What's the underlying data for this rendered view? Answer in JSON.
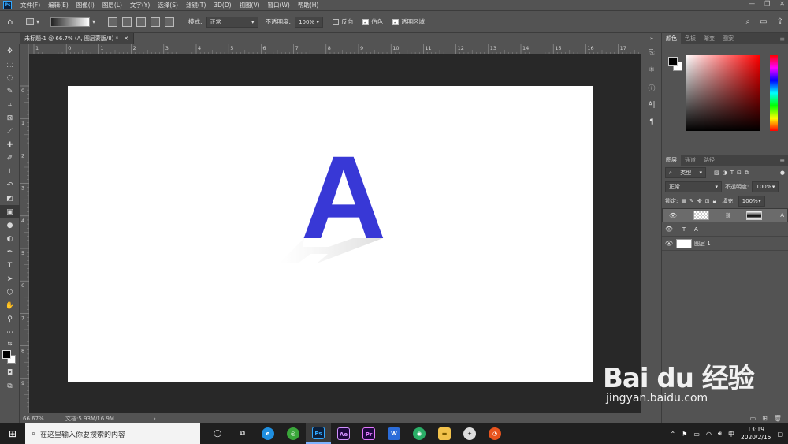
{
  "menubar": {
    "logo": "Ps",
    "items": [
      "文件(F)",
      "编辑(E)",
      "图像(I)",
      "图层(L)",
      "文字(Y)",
      "选择(S)",
      "滤镜(T)",
      "3D(D)",
      "视图(V)",
      "窗口(W)",
      "帮助(H)"
    ],
    "window_controls": [
      "—",
      "❐",
      "✕"
    ]
  },
  "options": {
    "mode_label": "模式:",
    "mode_value": "正常",
    "opacity_label": "不透明度:",
    "opacity_value": "100%",
    "reverse_label": "反向",
    "reverse_checked": false,
    "dither_label": "仿色",
    "dither_checked": true,
    "transparency_label": "透明区域",
    "transparency_checked": true
  },
  "document": {
    "tab_title": "未标题-1 @ 66.7% (A, 图层蒙版/8) *",
    "zoom": "66.67%",
    "doc_info": "文档:5.93M/16.9M",
    "letter": "A",
    "letter_color": "#3838d6"
  },
  "rulers": {
    "top": [
      "1",
      "0",
      "1",
      "2",
      "3",
      "4",
      "5",
      "6",
      "7",
      "8",
      "9",
      "10",
      "11",
      "12",
      "13",
      "14",
      "15",
      "16",
      "17"
    ],
    "left": [
      "0",
      "1",
      "2",
      "3",
      "4",
      "5",
      "6",
      "7",
      "8",
      "9"
    ]
  },
  "color_panel": {
    "tabs": [
      "颜色",
      "色板",
      "渐变",
      "图案"
    ],
    "active": 0
  },
  "layers_panel": {
    "tabs": [
      "图层",
      "通道",
      "路径"
    ],
    "active": 0,
    "filter_label": "类型",
    "blend_mode": "正常",
    "opacity_label": "不透明度:",
    "opacity_value": "100%",
    "lock_label": "锁定:",
    "fill_label": "填充:",
    "fill_value": "100%",
    "layers": [
      {
        "name": "A",
        "type": "masked",
        "selected": true
      },
      {
        "name": "A",
        "type": "text",
        "selected": false
      },
      {
        "name": "图层 1",
        "type": "pixel",
        "selected": false
      }
    ]
  },
  "taskbar": {
    "search_placeholder": "在这里输入你要搜索的内容",
    "apps": [
      {
        "label": "Ps",
        "bg": "#0b1f3a",
        "fg": "#31a8ff"
      },
      {
        "label": "Ae",
        "bg": "#1f0740",
        "fg": "#d291ff"
      },
      {
        "label": "Pr",
        "bg": "#1f0740",
        "fg": "#e579ff"
      },
      {
        "label": "W",
        "bg": "#2b6cd9",
        "fg": "#ffffff"
      }
    ],
    "ime": "中",
    "time": "13:19",
    "date": "2020/2/15"
  },
  "watermark": {
    "brand": "Bai du 经验",
    "url": "jingyan.baidu.com"
  }
}
